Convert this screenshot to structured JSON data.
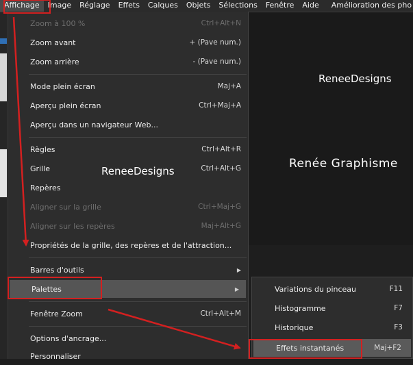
{
  "menubar": {
    "items": [
      "Affichage",
      "Image",
      "Réglage",
      "Effets",
      "Calques",
      "Objets",
      "Sélections",
      "Fenêtre",
      "Aide",
      "Amélioration des pho"
    ]
  },
  "menu": {
    "items": [
      {
        "label": "Zoom à 100 %",
        "shortcut": "Ctrl+Alt+N",
        "disabled": true
      },
      {
        "label": "Zoom avant",
        "shortcut": "+ (Pave num.)"
      },
      {
        "label": "Zoom arrière",
        "shortcut": "- (Pave num.)"
      },
      {
        "label": "Mode plein écran",
        "shortcut": "Maj+A"
      },
      {
        "label": "Aperçu plein écran",
        "shortcut": "Ctrl+Maj+A"
      },
      {
        "label": "Aperçu dans un navigateur Web...",
        "shortcut": ""
      },
      {
        "label": "Règles",
        "shortcut": "Ctrl+Alt+R"
      },
      {
        "label": "Grille",
        "shortcut": "Ctrl+Alt+G"
      },
      {
        "label": "Repères",
        "shortcut": ""
      },
      {
        "label": "Aligner sur la grille",
        "shortcut": "Ctrl+Maj+G",
        "disabled": true
      },
      {
        "label": "Aligner sur les repères",
        "shortcut": "Maj+Alt+G",
        "disabled": true
      },
      {
        "label": "Propriétés de la grille, des repères et de l'attraction...",
        "shortcut": ""
      },
      {
        "label": "Barres d'outils",
        "shortcut": "",
        "submenu": true
      },
      {
        "label": "Palettes",
        "shortcut": "",
        "submenu": true,
        "highlighted": true
      },
      {
        "label": "Fenêtre Zoom",
        "shortcut": "Ctrl+Alt+M"
      },
      {
        "label": "Options d'ancrage...",
        "shortcut": ""
      },
      {
        "label": "Personnaliser",
        "shortcut": ""
      }
    ]
  },
  "submenu": {
    "items": [
      {
        "label": "Variations du pinceau",
        "shortcut": "F11"
      },
      {
        "label": "Histogramme",
        "shortcut": "F7"
      },
      {
        "label": "Historique",
        "shortcut": "F3"
      },
      {
        "label": "Effets instantanés",
        "shortcut": "Maj+F2",
        "highlighted": true
      }
    ]
  },
  "watermarks": [
    "ReneeDesigns",
    "Renée Graphisme",
    "ReneeDesigns"
  ],
  "colors": {
    "annotation": "#d32020",
    "highlight": "#555555",
    "menu_bg": "#2d2d2d"
  }
}
